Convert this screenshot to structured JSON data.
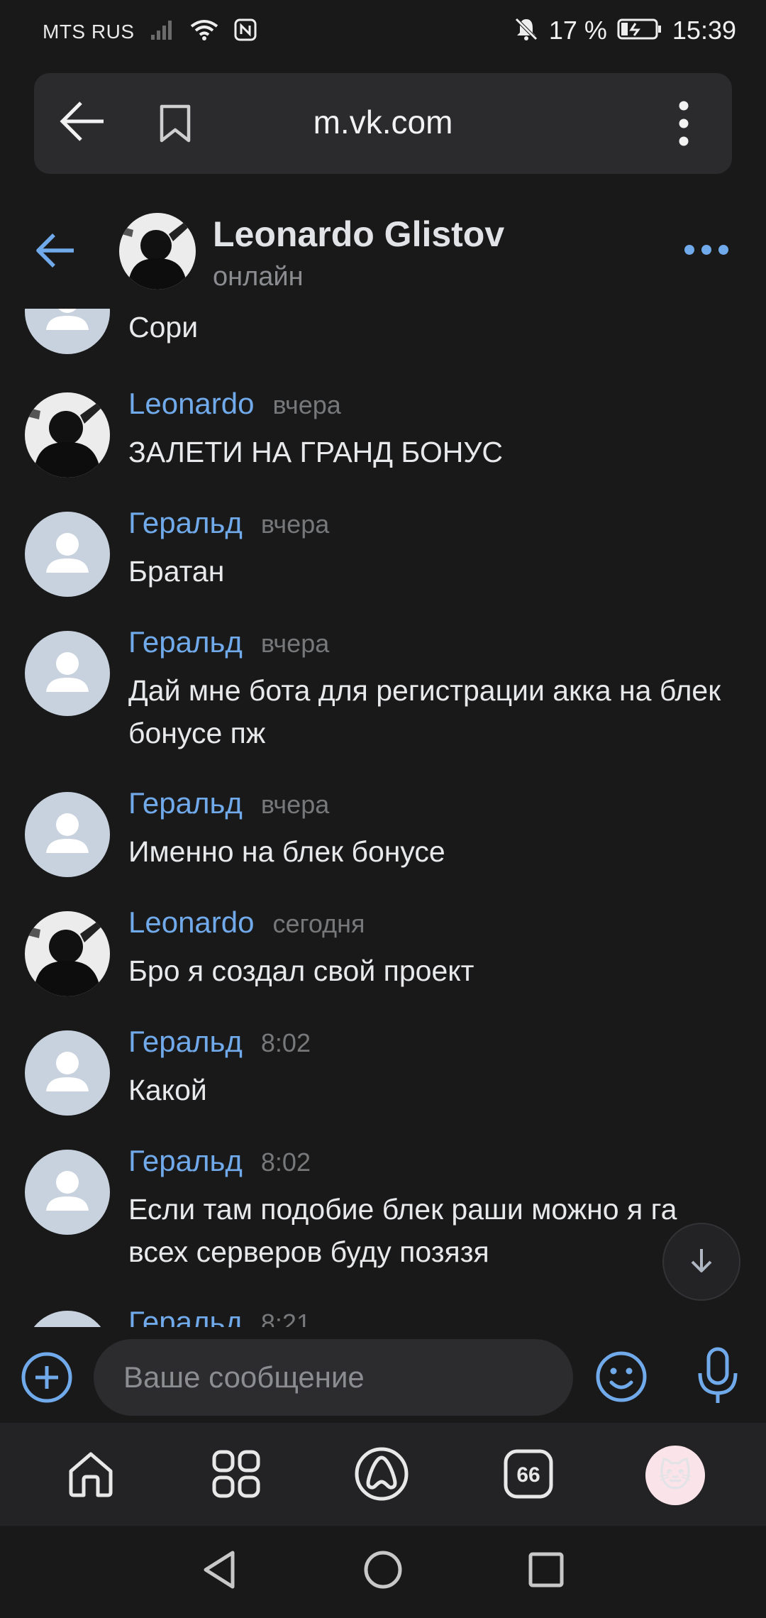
{
  "status_bar": {
    "carrier": "MTS RUS",
    "battery": "17 %",
    "time": "15:39",
    "icons": [
      "signal-icon",
      "wifi-icon",
      "nfc-icon",
      "mute-icon",
      "battery-icon"
    ]
  },
  "browser": {
    "url": "m.vk.com",
    "icons": [
      "back-arrow-icon",
      "bookmark-icon",
      "more-vert-icon"
    ]
  },
  "chat": {
    "name": "Leonardo Glistov",
    "status": "онлайн",
    "accent": "#71aaeb"
  },
  "messages": [
    {
      "author": "",
      "time": "",
      "text": "Сори",
      "avatar": "default"
    },
    {
      "author": "Leonardo",
      "time": "вчера",
      "text": "ЗАЛЕТИ НА ГРАНД БОНУС",
      "avatar": "photo"
    },
    {
      "author": "Геральд",
      "time": "вчера",
      "text": "Братан",
      "avatar": "default"
    },
    {
      "author": "Геральд",
      "time": "вчера",
      "text": "Дай мне бота для регистрации акка на блек бонусе пж",
      "avatar": "default"
    },
    {
      "author": "Геральд",
      "time": "вчера",
      "text": "Именно на блек бонусе",
      "avatar": "default"
    },
    {
      "author": "Leonardo",
      "time": "сегодня",
      "text": "Бро я создал свой проект",
      "avatar": "photo"
    },
    {
      "author": "Геральд",
      "time": "8:02",
      "text": "Какой",
      "avatar": "default"
    },
    {
      "author": "Геральд",
      "time": "8:02",
      "text": "Если там подобие блек раши можно я га всех серверов буду позязя",
      "avatar": "default"
    },
    {
      "author": "Геральд",
      "time": "8:21",
      "text": "",
      "avatar": "default"
    }
  ],
  "composer": {
    "placeholder": "Ваше сообщение"
  },
  "bottom_nav": {
    "messages_badge": "66",
    "items": [
      "home-icon",
      "services-icon",
      "alice-icon",
      "messages-icon",
      "profile-avatar"
    ]
  }
}
